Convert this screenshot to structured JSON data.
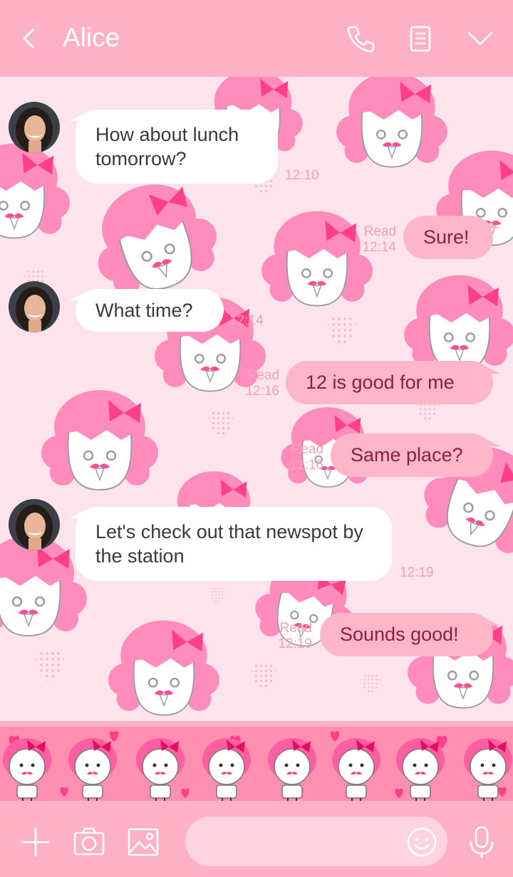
{
  "header": {
    "title": "Alice",
    "back_icon": "chevron-left-icon",
    "call_icon": "phone-icon",
    "notes_icon": "notes-icon",
    "menu_icon": "chevron-down-icon"
  },
  "messages": [
    {
      "direction": "in",
      "text": "How about lunch tomorrow?",
      "time": "12:10"
    },
    {
      "direction": "out",
      "text": "Sure!",
      "status": "Read",
      "time": "12:14"
    },
    {
      "direction": "in",
      "text": "What time?",
      "time": "12:14"
    },
    {
      "direction": "out",
      "text": "12 is good for me",
      "status": "Read",
      "time": "12:16"
    },
    {
      "direction": "out",
      "text": "Same place?",
      "status": "Read",
      "time": "12:16"
    },
    {
      "direction": "in",
      "text": "Let's check out that newspot by the station",
      "time": "12:19"
    },
    {
      "direction": "out",
      "text": "Sounds good!",
      "status": "Read",
      "time": "12:19"
    }
  ],
  "input_bar": {
    "add_icon": "plus-icon",
    "camera_icon": "camera-icon",
    "gallery_icon": "image-icon",
    "placeholder": "",
    "emoji_icon": "smiley-icon",
    "mic_icon": "microphone-icon"
  },
  "theme": {
    "header_color": "#ffb1c5",
    "background_color": "#fde3ec",
    "outgoing_bubble": "#ffb6c8",
    "incoming_bubble": "#ffffff",
    "sticker_strip": "#ff8fb0"
  }
}
